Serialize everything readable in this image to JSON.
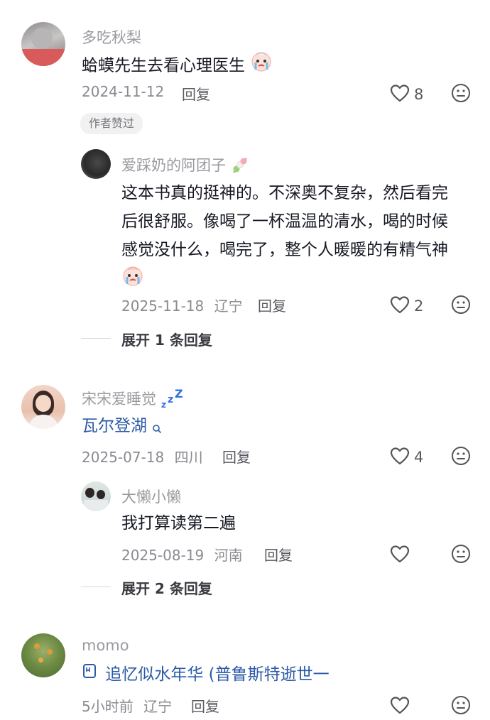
{
  "comments": [
    {
      "username": "多吃秋梨",
      "content": "蛤蟆先生去看心理医生",
      "date": "2024-11-12",
      "reply_label": "回复",
      "likes": "8",
      "badge": "作者赞过",
      "replies": [
        {
          "username": "爱踩奶的阿团子",
          "content_lines": [
            "这本书真的挺神的。不深奥不复杂，然后看完",
            "后很舒服。像喝了一杯温温的清水，喝的时候",
            "感觉没什么，喝完了，整个人暖暖的有精气神"
          ],
          "date": "2025-11-18",
          "location": "辽宁",
          "reply_label": "回复",
          "likes": "2"
        }
      ],
      "expand_label": "展开 1 条回复"
    },
    {
      "username": "宋宋爱睡觉",
      "content": "瓦尔登湖",
      "date": "2025-07-18",
      "location": "四川",
      "reply_label": "回复",
      "likes": "4",
      "replies": [
        {
          "username": "大懒小懒",
          "content": "我打算读第二遍",
          "date": "2025-08-19",
          "location": "河南",
          "reply_label": "回复",
          "likes": ""
        }
      ],
      "expand_label": "展开 2 条回复"
    },
    {
      "username": "momo",
      "content": "追忆似水年华 (普鲁斯特逝世一",
      "date": "5小时前",
      "location": "辽宁",
      "reply_label": "回复",
      "likes": ""
    }
  ],
  "icons": {
    "like": "heart-outline-icon",
    "dislike": "frown-face-icon",
    "book": "book-icon",
    "search_hint": "search-hint-icon"
  },
  "colors": {
    "text_primary": "#161823",
    "text_secondary": "#8a8a91",
    "link_blue": "#2b5aa6"
  }
}
